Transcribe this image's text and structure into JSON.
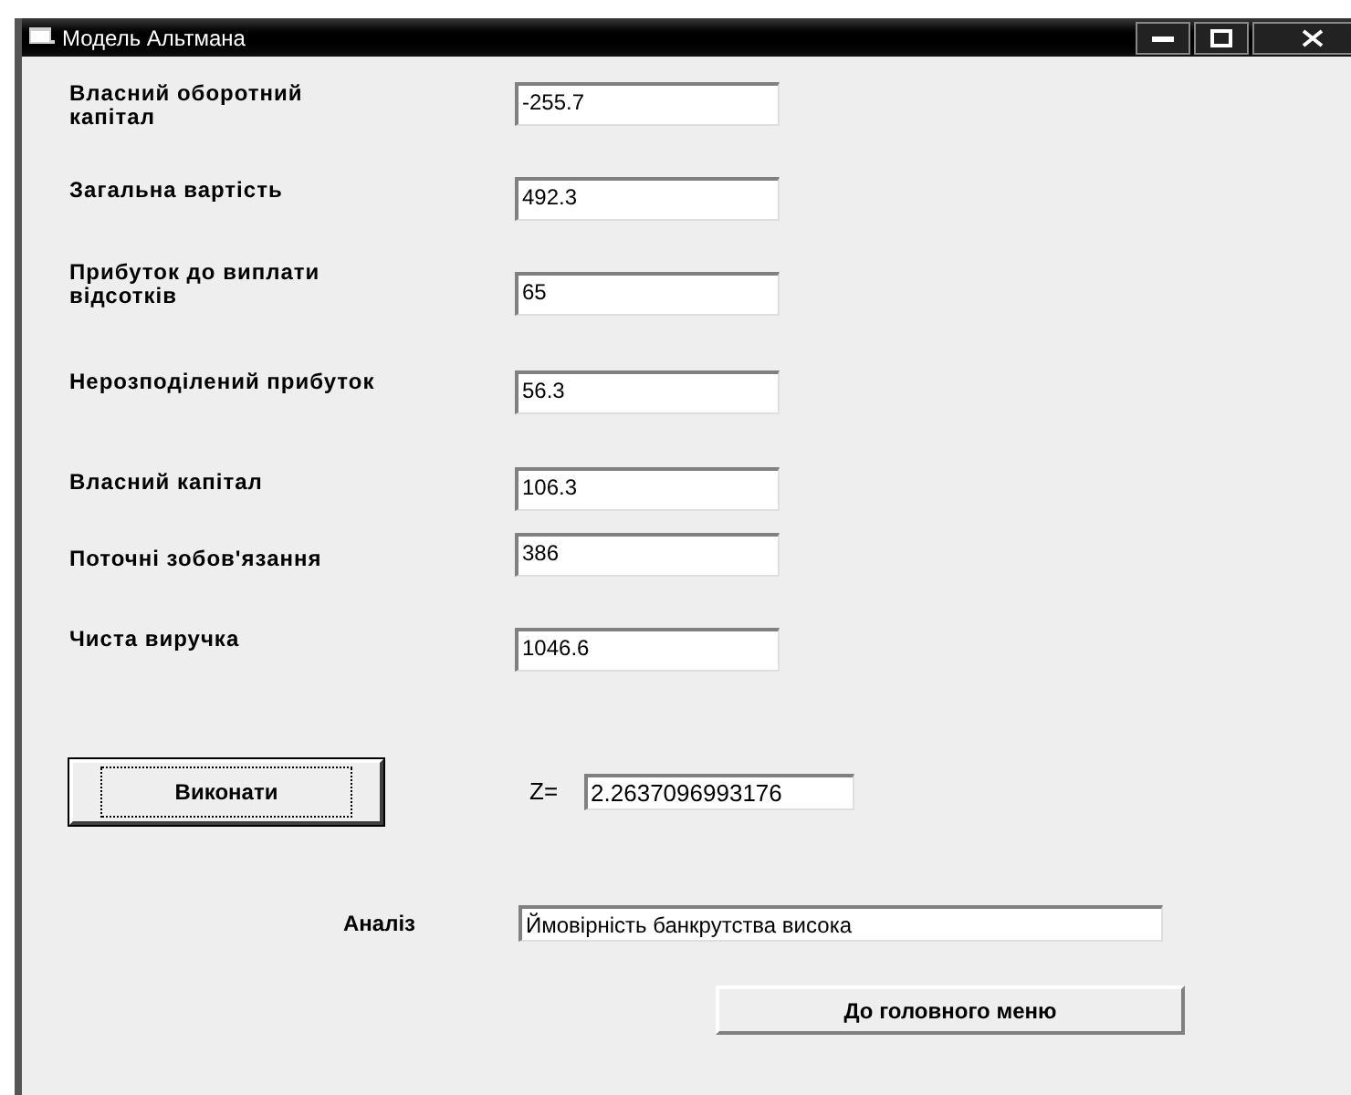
{
  "window": {
    "title": "Модель Альтмана"
  },
  "fields": [
    {
      "label": "Власний оборотний капітал",
      "value": "-255.7"
    },
    {
      "label": "Загальна вартість",
      "value": "492.3"
    },
    {
      "label": "Прибуток до виплати відсотків",
      "value": "65"
    },
    {
      "label": "Нерозподілений прибуток",
      "value": "56.3"
    },
    {
      "label": "Власний капітал",
      "value": "106.3"
    },
    {
      "label": "Поточні зобов'язання",
      "value": "386"
    },
    {
      "label": "Чиста виручка",
      "value": "1046.6"
    }
  ],
  "run_button": {
    "label": "Виконати",
    "focused": true
  },
  "z": {
    "label": "Z=",
    "value": "2.2637096993176"
  },
  "analysis": {
    "label": "Аналіз",
    "value": "Ймовірність банкрутства висока"
  },
  "menu_button": {
    "label": "До головного меню"
  }
}
